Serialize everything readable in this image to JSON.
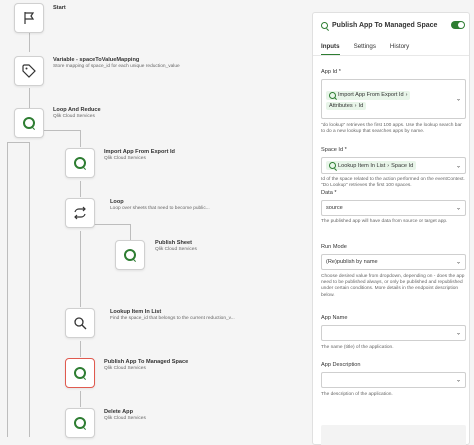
{
  "flow": {
    "start": {
      "title": "Start"
    },
    "variable": {
      "title": "Variable - spaceToValueMapping",
      "sub": "Store mapping of space_id for each unique reduction_value"
    },
    "loop_reduce": {
      "title": "Loop And Reduce",
      "sub": "Qlik Cloud Services"
    },
    "import_app": {
      "title": "Import App From Export Id",
      "sub": "Qlik Cloud Services"
    },
    "loop": {
      "title": "Loop",
      "sub": "Loop over sheets that need to become public..."
    },
    "publish_sheet": {
      "title": "Publish Sheet",
      "sub": "Qlik Cloud Services"
    },
    "lookup_item": {
      "title": "Lookup Item In List",
      "sub": "Find the space_id that belongs to the current reduction_v..."
    },
    "publish_app": {
      "title": "Publish App To Managed Space",
      "sub": "Qlik Cloud Services"
    },
    "delete_app": {
      "title": "Delete App",
      "sub": "Qlik Cloud Services"
    }
  },
  "panel": {
    "title": "Publish App To Managed Space",
    "tabs": [
      "Inputs",
      "Settings",
      "History"
    ],
    "app_id": {
      "label": "App Id *",
      "chip1": "Import App From Export Id",
      "chip2a": "Attributes",
      "chip2b": "Id",
      "help": "\"do lookup\" retrieves the first 100 apps. Use the lookup search bar to do a new lookup that searches apps by name."
    },
    "space_id": {
      "label": "Space Id *",
      "chip1": "Lookup Item In List",
      "chip2": "Space Id",
      "help": "Id of the space related to the action performed on the eventContext. \"Do Lookup\" retrieves the first 100 spaces."
    },
    "data": {
      "label": "Data *",
      "value": "source",
      "help": "The published app will have data from source or target app."
    },
    "run_mode": {
      "label": "Run Mode",
      "value": "(Re)publish by name",
      "help": "Choose desired value from dropdown, depending on - does the app need to be published always, or only be published and republished under certain conditions. More details in the endpoint description below."
    },
    "app_name": {
      "label": "App Name",
      "help": "The name (title) of the application."
    },
    "app_desc": {
      "label": "App Description",
      "help": "The description of the application."
    }
  },
  "colors": {
    "accent": "#2e7d32",
    "selected": "#e05a4f"
  }
}
